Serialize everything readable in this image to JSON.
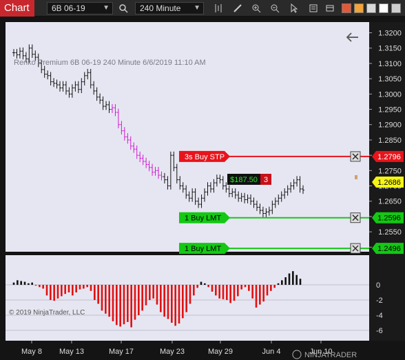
{
  "toolbar": {
    "title": "Chart",
    "instrument": "6B 06-19",
    "interval": "240 Minute",
    "icons": [
      "search-icon",
      "bar-type-icon",
      "drawing-tool-icon",
      "zoom-in-icon",
      "zoom-out-icon",
      "pointer-icon",
      "properties-icon",
      "chart-trader-icon"
    ],
    "swatches": [
      "#e05a3a",
      "#f2a33a",
      "#d8d8d8",
      "#ffffff",
      "#cfcfcf"
    ]
  },
  "header_text": "Renko Premium   6B 06-19   240 Minute   6/6/2019 11:10 AM",
  "copyright": "© 2019 NinjaTrader, LLC",
  "price_axis": {
    "labels": [
      "1.3200",
      "1.3150",
      "1.3100",
      "1.3050",
      "1.3000",
      "1.2950",
      "1.2900",
      "1.2850",
      "1.2800",
      "1.2750",
      "1.2700",
      "1.2650",
      "1.2600",
      "1.2550",
      "1.2500"
    ]
  },
  "indicator_axis": {
    "labels": [
      "0",
      "-2",
      "-4",
      "-6"
    ]
  },
  "date_axis": {
    "labels": [
      "May 8",
      "May 13",
      "May 17",
      "May 23",
      "May 29",
      "Jun 4",
      "Jun 10"
    ]
  },
  "orders": [
    {
      "label": "3s  Buy STP",
      "price": "1.2796",
      "color": "#e8141b"
    },
    {
      "label": "1  Buy LMT",
      "price": "1.2596",
      "color": "#14c814"
    },
    {
      "label": "1  Buy LMT",
      "price": "1.2496",
      "color": "#14c814"
    }
  ],
  "position": {
    "pnl": "$187.50",
    "qty": "3"
  },
  "last_price": "1.2686",
  "brand": "NINJATRADER",
  "chart_data": {
    "type": "ohlc",
    "ylim": [
      1.2485,
      1.3235
    ],
    "closes": [
      1.3135,
      1.3128,
      1.314,
      1.3125,
      1.3115,
      1.315,
      1.313,
      1.312,
      1.31,
      1.308,
      1.3065,
      1.306,
      1.304,
      1.3035,
      1.303,
      1.302,
      1.303,
      1.301,
      1.3,
      1.302,
      1.303,
      1.3015,
      1.304,
      1.306,
      1.307,
      1.303,
      1.301,
      1.299,
      1.298,
      1.296,
      1.2965,
      1.295,
      1.2955,
      1.294,
      1.29,
      1.288,
      1.286,
      1.285,
      1.283,
      1.282,
      1.28,
      1.279,
      1.278,
      1.277,
      1.276,
      1.2745,
      1.275,
      1.2735,
      1.273,
      1.272,
      1.27,
      1.28,
      1.276,
      1.272,
      1.27,
      1.269,
      1.267,
      1.266,
      1.268,
      1.265,
      1.264,
      1.266,
      1.268,
      1.27,
      1.269,
      1.271,
      1.2725,
      1.272,
      1.27,
      1.269,
      1.2675,
      1.268,
      1.267,
      1.266,
      1.2665,
      1.2655,
      1.266,
      1.265,
      1.264,
      1.263,
      1.262,
      1.261,
      1.2615,
      1.262,
      1.264,
      1.265,
      1.266,
      1.267,
      1.268,
      1.269,
      1.27,
      1.271,
      1.272,
      1.269,
      1.2686
    ],
    "indicator": [
      0.3,
      0.6,
      0.5,
      0.4,
      0.2,
      0.3,
      -0.1,
      -0.3,
      -0.5,
      -1.4,
      -2.0,
      -2.1,
      -1.8,
      -1.5,
      -1.2,
      -1.0,
      -1.4,
      -1.0,
      -0.6,
      -0.5,
      -0.3,
      -0.8,
      -2.0,
      -2.5,
      -3.4,
      -3.8,
      -4.2,
      -4.8,
      -5.3,
      -5.5,
      -5.2,
      -4.9,
      -5.6,
      -4.6,
      -4.0,
      -3.4,
      -2.7,
      -2.0,
      -1.8,
      -2.6,
      -3.6,
      -4.2,
      -4.5,
      -5.0,
      -5.4,
      -5.1,
      -4.4,
      -3.6,
      -2.5,
      -1.4,
      -0.4,
      0.4,
      0.2,
      -0.3,
      -0.9,
      -1.4,
      -1.8,
      -1.9,
      -2.0,
      -2.4,
      -2.1,
      -1.5,
      -0.6,
      -0.3,
      -0.8,
      -1.8,
      -3.0,
      -2.6,
      -2.2,
      -1.4,
      -0.8,
      -0.4,
      0.2,
      0.6,
      1.0,
      1.5,
      1.8,
      1.3,
      0.8
    ]
  }
}
